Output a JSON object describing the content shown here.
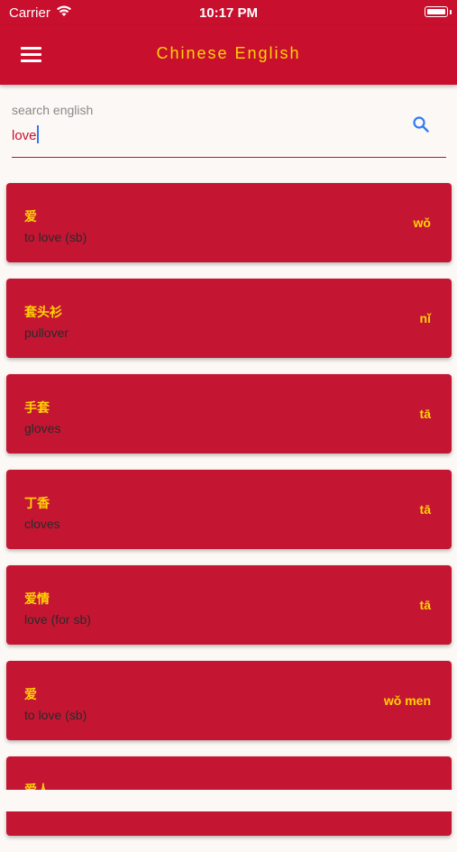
{
  "status_bar": {
    "carrier": "Carrier",
    "time": "10:17 PM"
  },
  "app_bar": {
    "title": "Chinese English"
  },
  "search": {
    "label": "search english",
    "value": "love"
  },
  "results": [
    {
      "hanzi": "爱",
      "english": "to love (sb)",
      "pinyin": "wǒ"
    },
    {
      "hanzi": "套头衫",
      "english": "pullover",
      "pinyin": "nǐ"
    },
    {
      "hanzi": "手套",
      "english": "gloves",
      "pinyin": "tā"
    },
    {
      "hanzi": "丁香",
      "english": "cloves",
      "pinyin": "tā"
    },
    {
      "hanzi": "爱情",
      "english": "love (for sb)",
      "pinyin": "tā"
    },
    {
      "hanzi": "爱",
      "english": "to love (sb)",
      "pinyin": "wǒ men"
    },
    {
      "hanzi": "爱人",
      "english": "",
      "pinyin": ""
    }
  ],
  "colors": {
    "primary": "#c8102e",
    "accent": "#ffd400",
    "background": "#fcf8f5",
    "search_icon": "#2f7bf5"
  }
}
